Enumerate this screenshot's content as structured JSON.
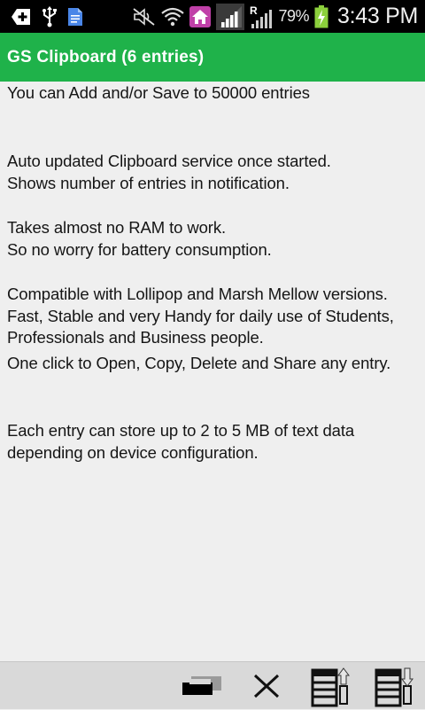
{
  "status_bar": {
    "left_icons": [
      "add-notification-icon",
      "usb-icon",
      "document-icon",
      "mute-icon",
      "wifi-icon",
      "home-icon"
    ],
    "right_icons": [
      "signal-icon",
      "roaming-signal-icon",
      "battery-charging-icon"
    ],
    "battery_percent": "79%",
    "roaming_indicator": "R",
    "time": "3:43 PM"
  },
  "app_bar": {
    "title": "GS Clipboard (6 entries)",
    "color": "#1fb24a"
  },
  "content": {
    "paragraphs": [
      "You can Add and/or Save to 50000 entries",
      "Auto updated Clipboard service once started.\nShows number of entries in notification.",
      "Takes almost no RAM to work.\nSo no worry for battery consumption.",
      "Compatible with Lollipop and Marsh Mellow versions.\nFast, Stable and very Handy for daily use of Students,\nProfessionals and Business people.",
      "One click to Open, Copy, Delete and Share any entry.",
      "Each entry can store up to 2 to 5 MB of text data\ndepending on device configuration."
    ]
  },
  "toolbar": {
    "buttons": [
      "copy-icon",
      "delete-icon",
      "export-icon",
      "import-icon"
    ]
  }
}
